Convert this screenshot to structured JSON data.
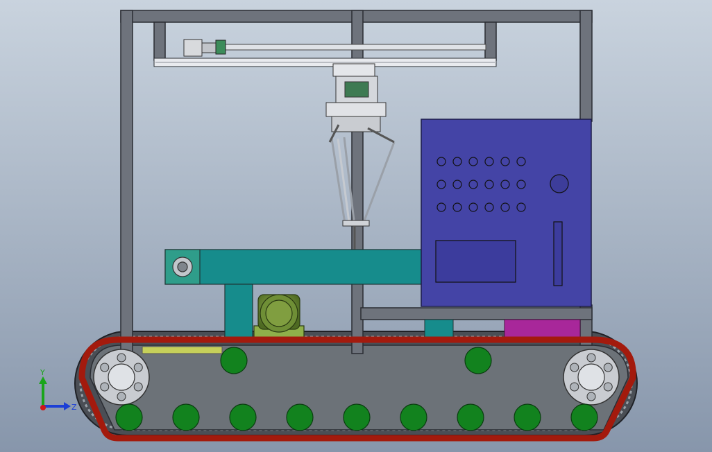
{
  "viewport": {
    "background_top": "#c9d3de",
    "background_bottom": "#8796ab"
  },
  "triad": {
    "y_label": "Y",
    "z_label": "Z",
    "y_color": "#1aa51a",
    "z_color": "#1c3fd6",
    "x_color": "#d01818"
  },
  "colors": {
    "frame": "#6e737c",
    "frame_edge": "#2a2d33",
    "control_box": "#4444a6",
    "conveyor": "#168c8c",
    "motor": "#6f8f36",
    "track_belt": "#a31a0d",
    "roller": "#12821e",
    "magenta_block": "#a8279a",
    "track_plate": "#6c7278"
  },
  "control_panel": {
    "button_rows": 3,
    "buttons_per_row": 6
  }
}
